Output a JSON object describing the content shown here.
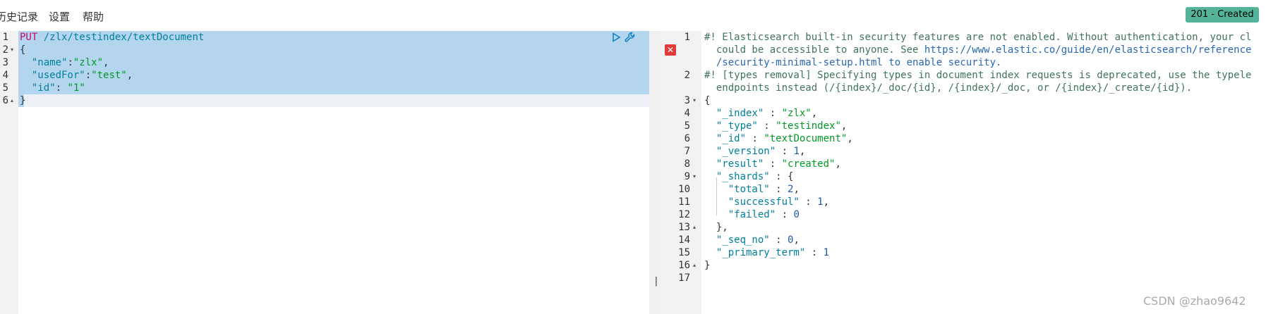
{
  "toolbar": {
    "menu": [
      "历史记录",
      "设置",
      "帮助"
    ],
    "status": "201 - Created",
    "status_color": "#54b399"
  },
  "request_editor": {
    "line_numbers": [
      "1",
      "2",
      "3",
      "4",
      "5",
      "6"
    ],
    "lines": [
      [
        {
          "t": "PUT",
          "c": "method"
        },
        {
          "t": " /zlx/testindex/textDocument",
          "c": "url"
        }
      ],
      [
        {
          "t": "{",
          "c": "plain"
        }
      ],
      [
        {
          "t": "  ",
          "c": "plain"
        },
        {
          "t": "\"name\"",
          "c": "key"
        },
        {
          "t": ":",
          "c": "plain"
        },
        {
          "t": "\"zlx\"",
          "c": "str"
        },
        {
          "t": ",",
          "c": "plain"
        }
      ],
      [
        {
          "t": "  ",
          "c": "plain"
        },
        {
          "t": "\"usedFor\"",
          "c": "key"
        },
        {
          "t": ":",
          "c": "plain"
        },
        {
          "t": "\"test\"",
          "c": "str"
        },
        {
          "t": ",",
          "c": "plain"
        }
      ],
      [
        {
          "t": "  ",
          "c": "plain"
        },
        {
          "t": "\"id\"",
          "c": "key"
        },
        {
          "t": ": ",
          "c": "plain"
        },
        {
          "t": "\"1\"",
          "c": "str"
        }
      ],
      [
        {
          "t": "}",
          "c": "plain"
        }
      ]
    ],
    "icons": [
      "play-icon",
      "wrench-icon"
    ]
  },
  "response_editor": {
    "line_numbers": [
      "1",
      "",
      "",
      "2",
      "",
      "3",
      "4",
      "5",
      "6",
      "7",
      "8",
      "9",
      "10",
      "11",
      "12",
      "13",
      "14",
      "15",
      "16",
      "17"
    ],
    "lines": [
      [
        {
          "t": "#! Elasticsearch built-in security features are not enabled. Without authentication, your cl",
          "c": "comment"
        }
      ],
      [
        {
          "t": "  could be accessible to anyone. See ",
          "c": "comment"
        },
        {
          "t": "https://www.elastic.co/guide/en/elasticsearch/reference",
          "c": "link"
        }
      ],
      [
        {
          "t": "  /security-minimal-setup.html to enable security.",
          "c": "link"
        }
      ],
      [
        {
          "t": "#! [types removal] Specifying types in document index requests is deprecated, use the typele",
          "c": "comment"
        }
      ],
      [
        {
          "t": "  endpoints instead (/{index}/_doc/{id}, /{index}/_doc, or /{index}/_create/{id}).",
          "c": "comment"
        }
      ],
      [
        {
          "t": "{",
          "c": "plain"
        }
      ],
      [
        {
          "t": "  ",
          "c": "plain"
        },
        {
          "t": "\"_index\"",
          "c": "key"
        },
        {
          "t": " : ",
          "c": "plain"
        },
        {
          "t": "\"zlx\"",
          "c": "str"
        },
        {
          "t": ",",
          "c": "plain"
        }
      ],
      [
        {
          "t": "  ",
          "c": "plain"
        },
        {
          "t": "\"_type\"",
          "c": "key"
        },
        {
          "t": " : ",
          "c": "plain"
        },
        {
          "t": "\"testindex\"",
          "c": "str"
        },
        {
          "t": ",",
          "c": "plain"
        }
      ],
      [
        {
          "t": "  ",
          "c": "plain"
        },
        {
          "t": "\"_id\"",
          "c": "key"
        },
        {
          "t": " : ",
          "c": "plain"
        },
        {
          "t": "\"textDocument\"",
          "c": "str"
        },
        {
          "t": ",",
          "c": "plain"
        }
      ],
      [
        {
          "t": "  ",
          "c": "plain"
        },
        {
          "t": "\"_version\"",
          "c": "key"
        },
        {
          "t": " : ",
          "c": "plain"
        },
        {
          "t": "1",
          "c": "num"
        },
        {
          "t": ",",
          "c": "plain"
        }
      ],
      [
        {
          "t": "  ",
          "c": "plain"
        },
        {
          "t": "\"result\"",
          "c": "key"
        },
        {
          "t": " : ",
          "c": "plain"
        },
        {
          "t": "\"created\"",
          "c": "str"
        },
        {
          "t": ",",
          "c": "plain"
        }
      ],
      [
        {
          "t": "  ",
          "c": "plain"
        },
        {
          "t": "\"_shards\"",
          "c": "key"
        },
        {
          "t": " : {",
          "c": "plain"
        }
      ],
      [
        {
          "t": "    ",
          "c": "plain"
        },
        {
          "t": "\"total\"",
          "c": "key"
        },
        {
          "t": " : ",
          "c": "plain"
        },
        {
          "t": "2",
          "c": "num"
        },
        {
          "t": ",",
          "c": "plain"
        }
      ],
      [
        {
          "t": "    ",
          "c": "plain"
        },
        {
          "t": "\"successful\"",
          "c": "key"
        },
        {
          "t": " : ",
          "c": "plain"
        },
        {
          "t": "1",
          "c": "num"
        },
        {
          "t": ",",
          "c": "plain"
        }
      ],
      [
        {
          "t": "    ",
          "c": "plain"
        },
        {
          "t": "\"failed\"",
          "c": "key"
        },
        {
          "t": " : ",
          "c": "plain"
        },
        {
          "t": "0",
          "c": "num"
        }
      ],
      [
        {
          "t": "  },",
          "c": "plain"
        }
      ],
      [
        {
          "t": "  ",
          "c": "plain"
        },
        {
          "t": "\"_seq_no\"",
          "c": "key"
        },
        {
          "t": " : ",
          "c": "plain"
        },
        {
          "t": "0",
          "c": "num"
        },
        {
          "t": ",",
          "c": "plain"
        }
      ],
      [
        {
          "t": "  ",
          "c": "plain"
        },
        {
          "t": "\"_primary_term\"",
          "c": "key"
        },
        {
          "t": " : ",
          "c": "plain"
        },
        {
          "t": "1",
          "c": "num"
        }
      ],
      [
        {
          "t": "}",
          "c": "plain"
        }
      ],
      [
        {
          "t": "",
          "c": "plain"
        }
      ]
    ],
    "icons": [
      "error-icon"
    ]
  },
  "divider": {
    "handle": "||"
  },
  "watermark": "CSDN @zhao9642"
}
